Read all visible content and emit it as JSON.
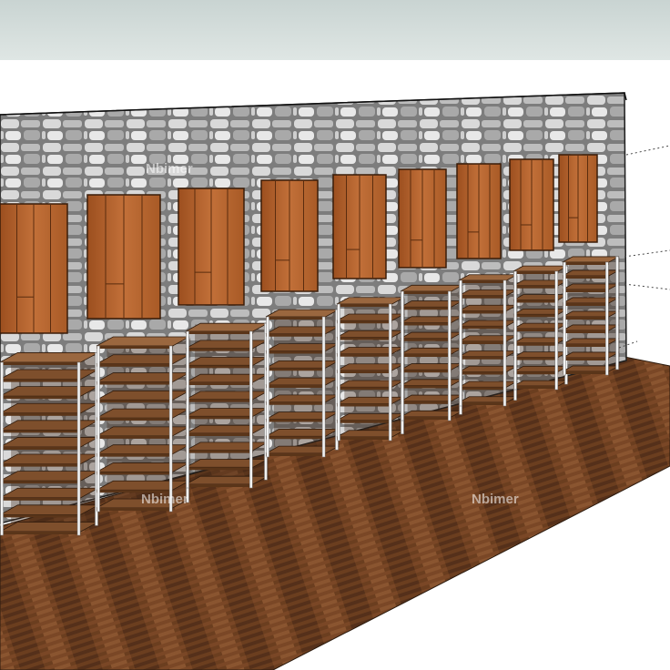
{
  "scene": {
    "subject": "sketchup-render",
    "watermarks": [
      "Nbimer",
      "Nbimer",
      "Nbimer"
    ],
    "colors": {
      "sky_top": "#c9d4d2",
      "stone_base": "#8a8a8a",
      "panel_wood": "#b4642c",
      "shelf_wood": "#8b5a34",
      "floor_wood": "#6b3e1f"
    },
    "counts": {
      "wall_panels": 9,
      "shelf_units": 9
    }
  }
}
